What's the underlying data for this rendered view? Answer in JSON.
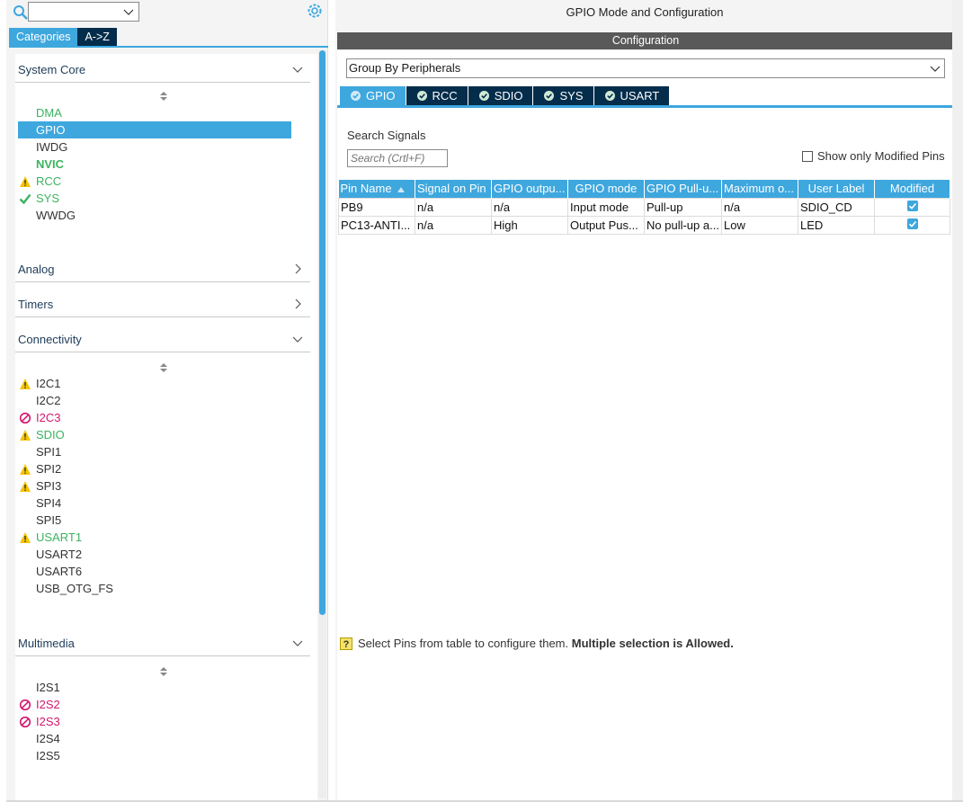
{
  "left_panel": {
    "view_tabs": [
      {
        "label": "Categories",
        "active": true
      },
      {
        "label": "A->Z",
        "active": false
      }
    ],
    "sections": [
      {
        "title": "System Core",
        "expanded": true,
        "items": [
          {
            "label": "DMA",
            "status": "ok-configured",
            "icon": "none"
          },
          {
            "label": "GPIO",
            "status": "selected",
            "icon": "none"
          },
          {
            "label": "IWDG",
            "status": "plain",
            "icon": "none"
          },
          {
            "label": "NVIC",
            "status": "modified",
            "icon": "none"
          },
          {
            "label": "RCC",
            "status": "warning",
            "icon": "warning-icon"
          },
          {
            "label": "SYS",
            "status": "ok",
            "icon": "check-icon"
          },
          {
            "label": "WWDG",
            "status": "plain",
            "icon": "none"
          }
        ]
      },
      {
        "title": "Analog",
        "expanded": false,
        "items": []
      },
      {
        "title": "Timers",
        "expanded": false,
        "items": []
      },
      {
        "title": "Connectivity",
        "expanded": true,
        "items": [
          {
            "label": "I2C1",
            "status": "warning-plain",
            "icon": "warning-icon"
          },
          {
            "label": "I2C2",
            "status": "plain",
            "icon": "none"
          },
          {
            "label": "I2C3",
            "status": "conflict",
            "icon": "blocked-icon"
          },
          {
            "label": "SDIO",
            "status": "warning",
            "icon": "warning-icon"
          },
          {
            "label": "SPI1",
            "status": "plain",
            "icon": "none"
          },
          {
            "label": "SPI2",
            "status": "warning-plain",
            "icon": "warning-icon"
          },
          {
            "label": "SPI3",
            "status": "warning-plain",
            "icon": "warning-icon"
          },
          {
            "label": "SPI4",
            "status": "plain",
            "icon": "none"
          },
          {
            "label": "SPI5",
            "status": "plain",
            "icon": "none"
          },
          {
            "label": "USART1",
            "status": "warning",
            "icon": "warning-icon"
          },
          {
            "label": "USART2",
            "status": "plain",
            "icon": "none"
          },
          {
            "label": "USART6",
            "status": "plain",
            "icon": "none"
          },
          {
            "label": "USB_OTG_FS",
            "status": "plain",
            "icon": "none"
          }
        ]
      },
      {
        "title": "Multimedia",
        "expanded": true,
        "items": [
          {
            "label": "I2S1",
            "status": "plain",
            "icon": "none"
          },
          {
            "label": "I2S2",
            "status": "conflict",
            "icon": "blocked-icon"
          },
          {
            "label": "I2S3",
            "status": "conflict",
            "icon": "blocked-icon"
          },
          {
            "label": "I2S4",
            "status": "plain",
            "icon": "none"
          },
          {
            "label": "I2S5",
            "status": "plain",
            "icon": "none"
          }
        ]
      }
    ]
  },
  "right_panel": {
    "title": "GPIO Mode and Configuration",
    "config_bar": "Configuration",
    "group_select": {
      "value": "Group By Peripherals"
    },
    "peripheral_tabs": [
      {
        "label": "GPIO",
        "active": true
      },
      {
        "label": "RCC",
        "active": false
      },
      {
        "label": "SDIO",
        "active": false
      },
      {
        "label": "SYS",
        "active": false
      },
      {
        "label": "USART",
        "active": false
      }
    ],
    "search_label": "Search Signals",
    "search_placeholder": "Search (Crtl+F)",
    "show_modified_label": "Show only Modified Pins",
    "table": {
      "columns": [
        "Pin Name",
        "Signal on Pin",
        "GPIO outpu...",
        "GPIO mode",
        "GPIO Pull-u...",
        "Maximum o...",
        "User Label",
        "Modified"
      ],
      "rows": [
        [
          "PB9",
          "n/a",
          "n/a",
          "Input mode",
          "Pull-up",
          "n/a",
          "SDIO_CD",
          true
        ],
        [
          "PC13-ANTI...",
          "n/a",
          "High",
          "Output Pus...",
          "No pull-up a...",
          "Low",
          "LED",
          true
        ]
      ]
    },
    "hint": {
      "text": "Select Pins from table to configure them. ",
      "bold": "Multiple selection is Allowed."
    }
  },
  "colors": {
    "accent": "#3ea7de",
    "navy": "#042d4b",
    "ok_green": "#3bb35f",
    "conflict_magenta": "#d4176f",
    "warning_yellow": "#f5c400"
  }
}
